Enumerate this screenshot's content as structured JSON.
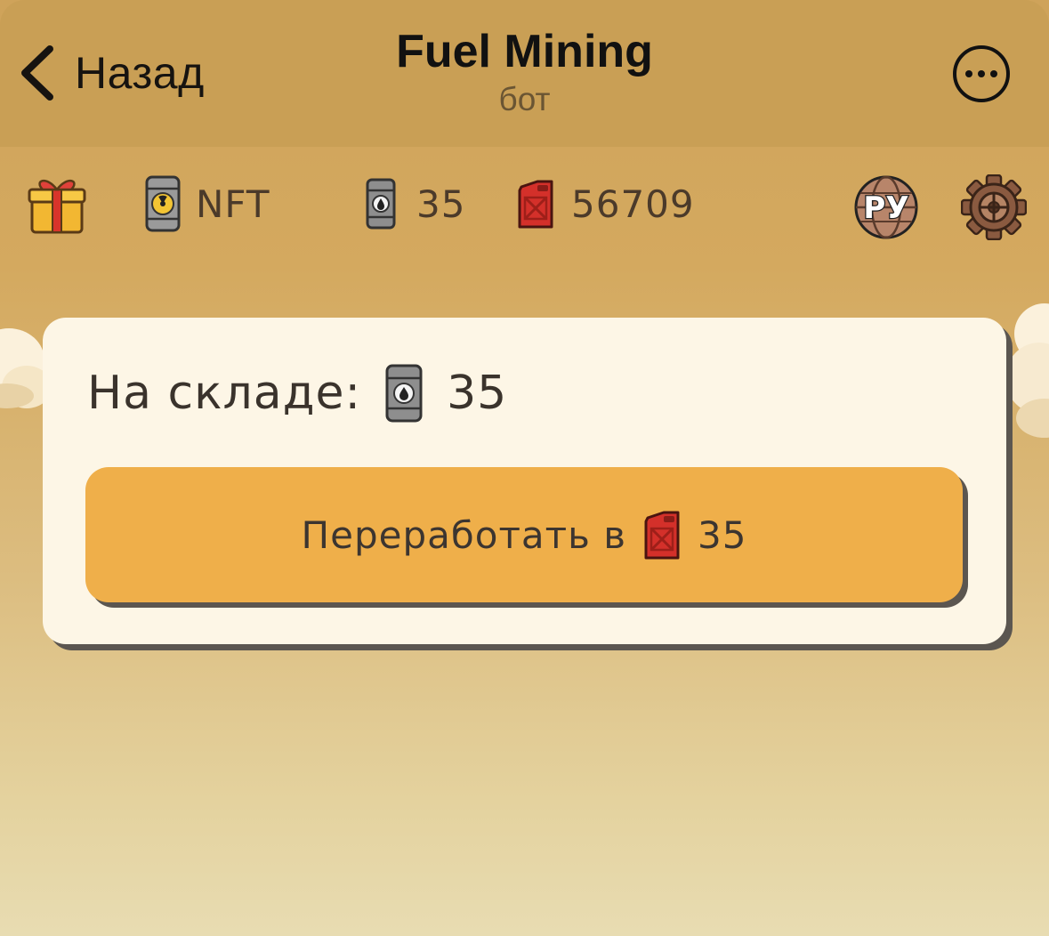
{
  "header": {
    "back_label": "Назад",
    "title": "Fuel Mining",
    "subtitle": "бот"
  },
  "topbar": {
    "gift_icon": "gift-icon",
    "nft": {
      "icon": "radioactive-barrel-icon",
      "label": "NFT"
    },
    "oil": {
      "icon": "oil-barrel-icon",
      "value": "35"
    },
    "fuel": {
      "icon": "fuel-canister-icon",
      "value": "56709"
    },
    "language": {
      "icon": "language-globe-icon",
      "label": "РУ"
    },
    "settings_icon": "gear-icon"
  },
  "card": {
    "stock_label": "На складе:",
    "stock_value": "35",
    "process_label": "Переработать в",
    "process_value": "35"
  },
  "colors": {
    "header_bg": "#c99f55",
    "card_bg": "#fdf6e6",
    "button_bg": "#efaf4a",
    "shadow": "#5b5650",
    "fuel_red": "#d4302a"
  }
}
